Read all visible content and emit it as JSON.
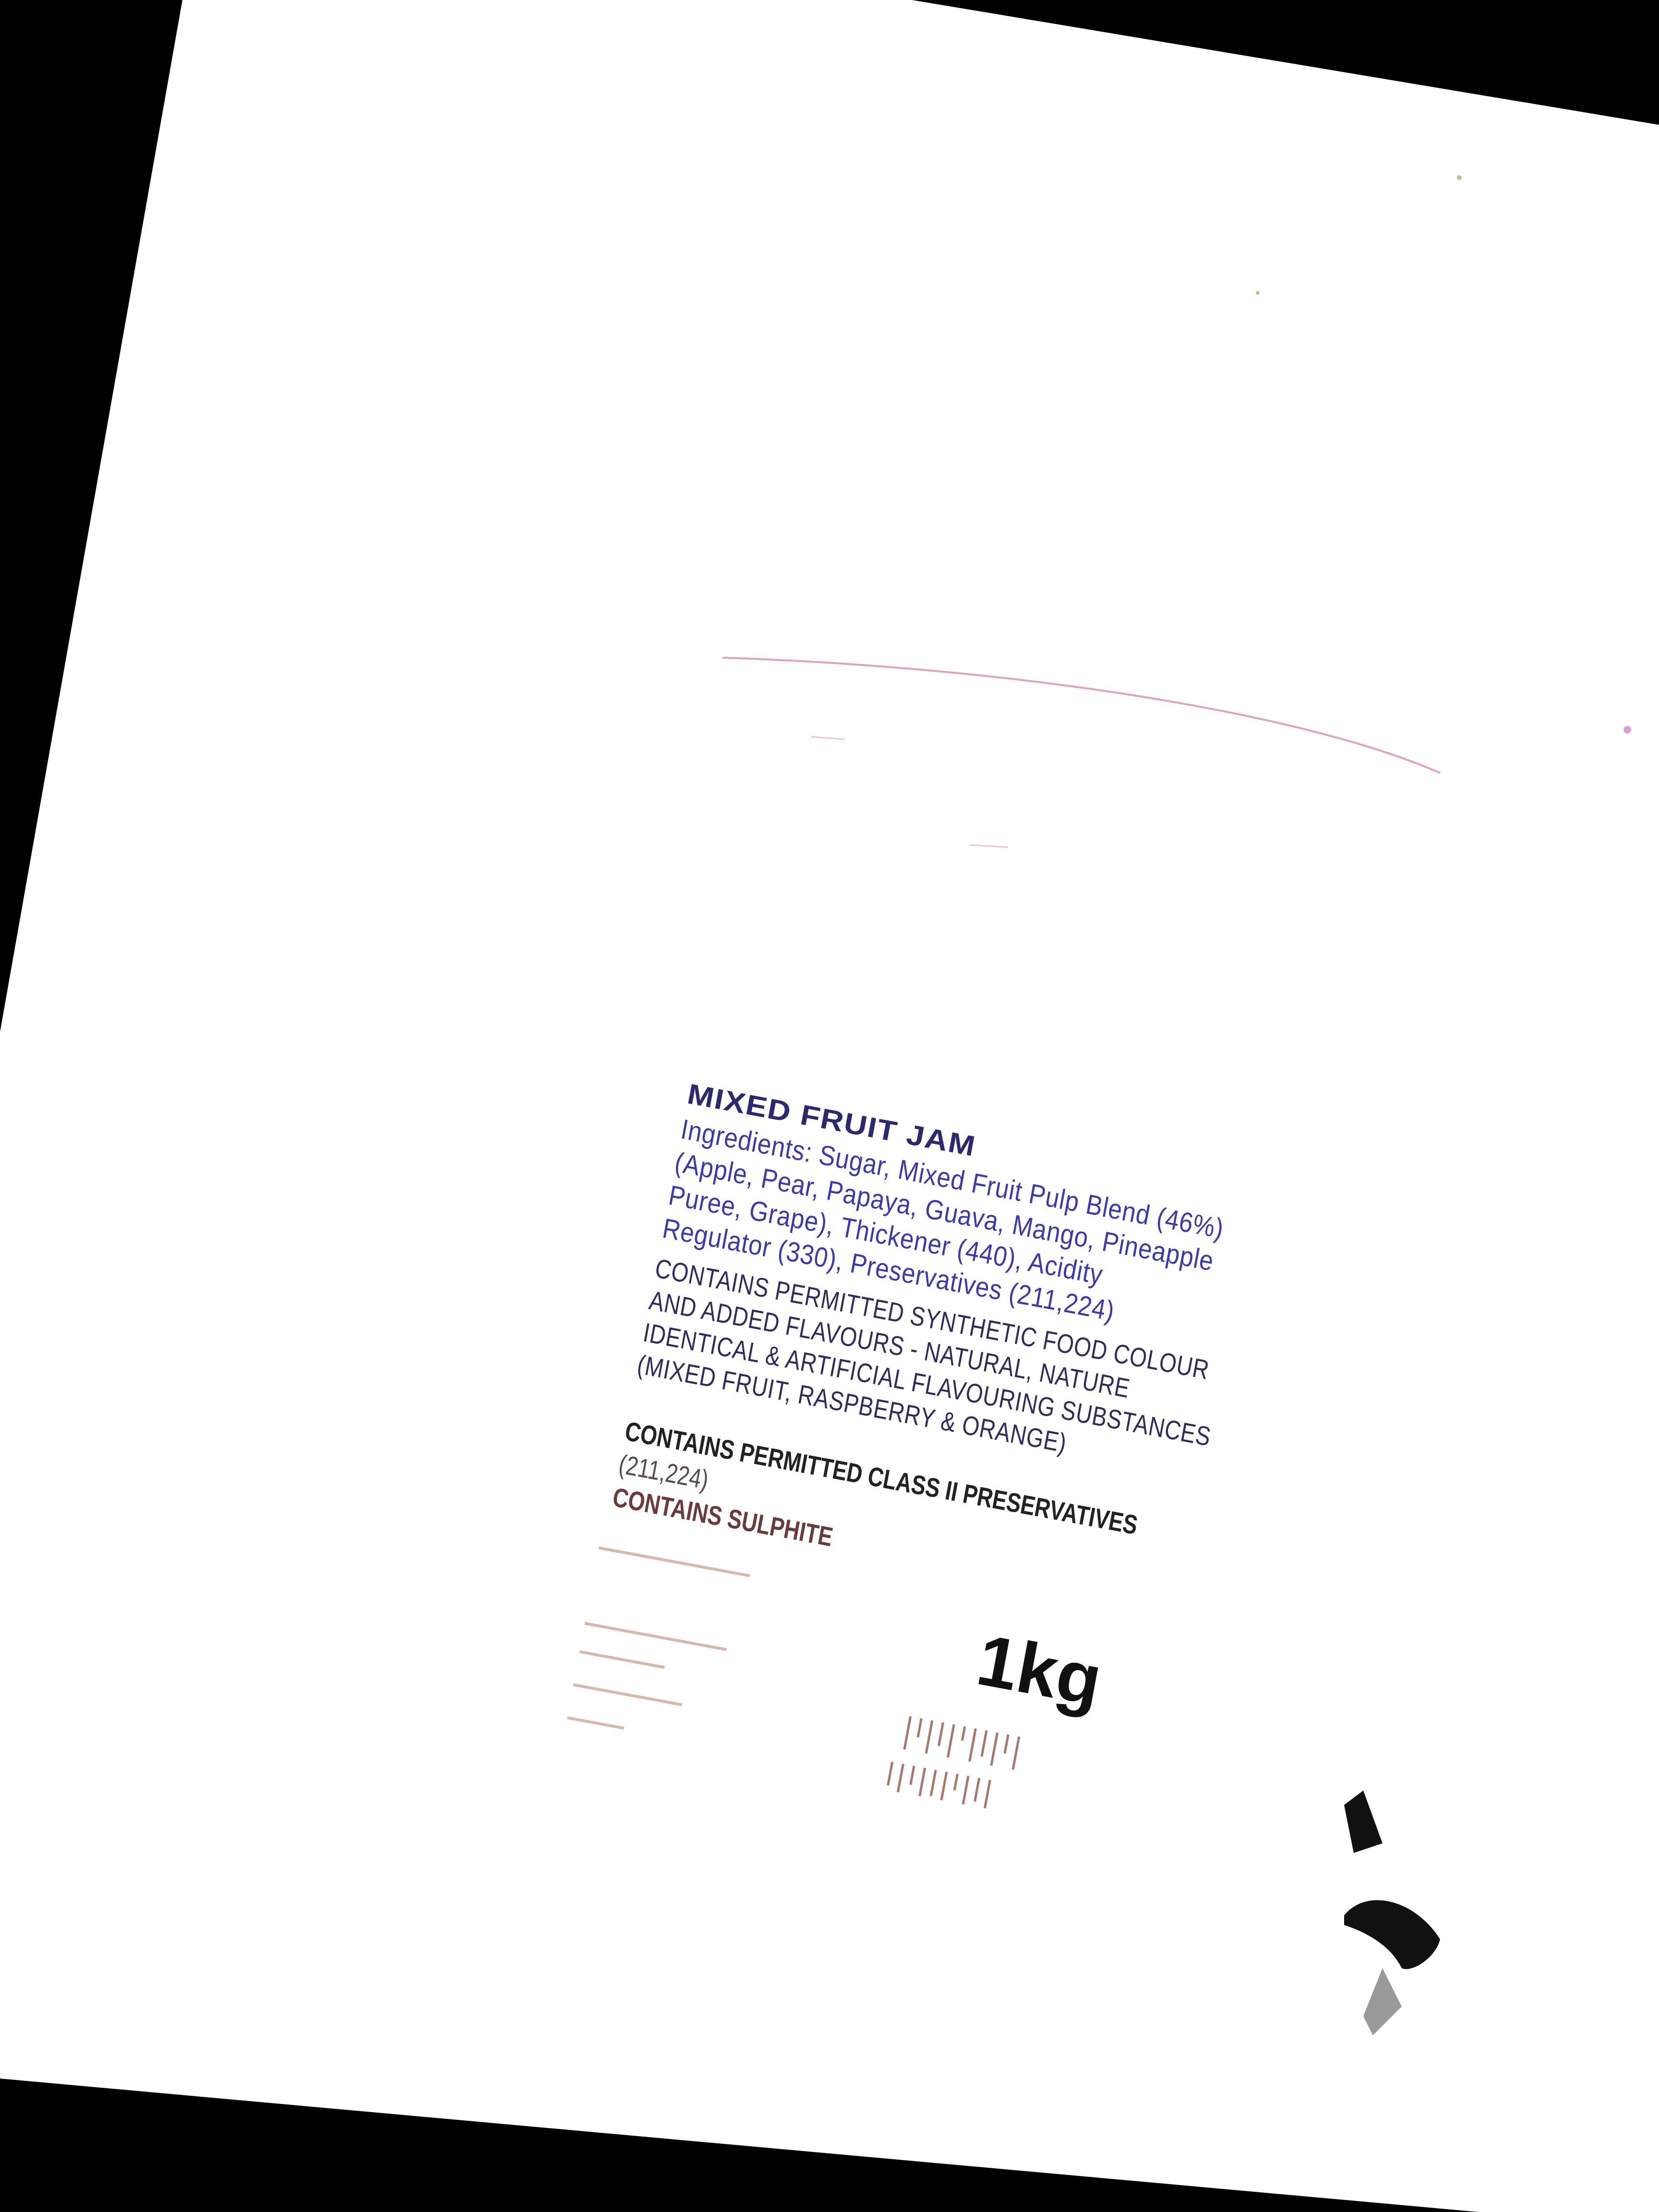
{
  "product": {
    "title": "MIXED FRUIT JAM",
    "ingredients": [
      "Ingredients: Sugar, Mixed Fruit Pulp Blend (46%)",
      "(Apple, Pear, Papaya, Guava, Mango, Pineapple",
      "Puree, Grape), Thickener (440), Acidity",
      "Regulator (330), Preservatives (211,224)"
    ],
    "notices": [
      "CONTAINS PERMITTED SYNTHETIC FOOD COLOUR",
      "AND ADDED FLAVOURS - NATURAL, NATURE",
      "IDENTICAL & ARTIFICIAL FLAVOURING SUBSTANCES",
      "(MIXED FRUIT, RASPBERRY & ORANGE)"
    ],
    "preservatives": "CONTAINS PERMITTED CLASS II PRESERVATIVES",
    "preservative_codes": "(211,224)",
    "sulphite": "CONTAINS SULPHITE",
    "net_weight": "1kg"
  },
  "colors": {
    "background": "#000000",
    "paper": "#ffffff",
    "ink_blue": "#3b3aa8",
    "ink_dark": "#222222",
    "ink_red": "#c04060"
  }
}
